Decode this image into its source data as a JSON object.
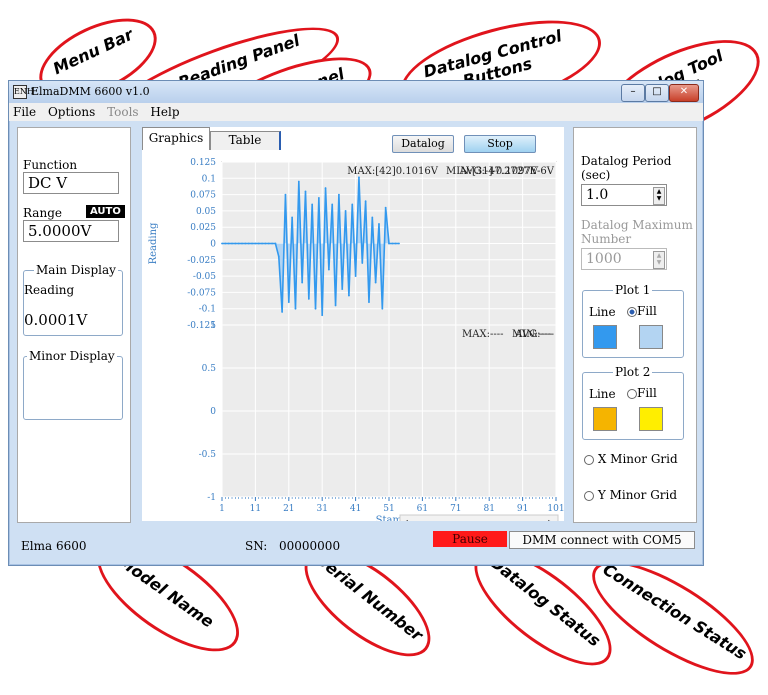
{
  "window": {
    "title": "ElmaDMM 6600 v1.0",
    "app_icon": "ENH"
  },
  "menu": {
    "items": [
      "File",
      "Options",
      "Tools",
      "Help"
    ]
  },
  "meter": {
    "function_label": "Function",
    "function_value": "DC V",
    "range_label": "Range",
    "range_mode": "AUTO",
    "range_value": "5.0000V",
    "main_display_label": "Main Display",
    "reading_label": "Reading",
    "reading_value": "0.0001V",
    "minor_display_label": "Minor Display"
  },
  "datalog": {
    "tabs": [
      "Graphics",
      "Table"
    ],
    "datalog_button": "Datalog",
    "stop_button": "Stop",
    "plot1": {
      "ylabel": "Reading",
      "yticks": [
        "0.125",
        "0.1",
        "0.075",
        "0.05",
        "0.025",
        "0",
        "-0.025",
        "-0.05",
        "-0.075",
        "-0.1",
        "-0.125"
      ],
      "stats": {
        "max": "MAX:[42]0.1016V",
        "min": "MIN:[31]-0.1097V",
        "avg": "AVG:-47.2727E-6V"
      }
    },
    "plot2": {
      "yticks": [
        "1",
        "0.5",
        "0",
        "-0.5",
        "-1"
      ],
      "xticks": [
        "1",
        "11",
        "21",
        "31",
        "41",
        "51",
        "61",
        "71",
        "81",
        "91",
        "101"
      ],
      "xlabel": "Stamp",
      "stats": {
        "max": "MAX:----",
        "min": "MIN:----",
        "avg": "AVG:----"
      }
    }
  },
  "tool": {
    "period_label": "Datalog Period",
    "period_unit": "(sec)",
    "period_value": "1.0",
    "max_label": "Datalog Maximum",
    "max_label2": "Number",
    "max_value": "1000",
    "plot1_label": "Plot 1",
    "plot2_label": "Plot 2",
    "line_label": "Line",
    "fill_label": "Fill",
    "plot1_line_color": "#3399ee",
    "plot1_fill_color": "#b3d4f2",
    "plot2_line_color": "#f5b400",
    "plot2_fill_color": "#ffee00",
    "x_minor_grid": "X Minor Grid",
    "y_minor_grid": "Y Minor Grid"
  },
  "status": {
    "model": "Elma 6600",
    "sn_label": "SN:",
    "sn_value": "00000000",
    "datalog_status": "Pause",
    "connection": "DMM connect with COM5"
  },
  "annotations": [
    "Menu Bar",
    "Meter Reading Panel",
    "Datalog Panel",
    "Datalog Control Buttons",
    "Datalog Tool Panel",
    "Model Name",
    "Serial Number",
    "Datalog Status",
    "Connection Status"
  ],
  "chart_data": {
    "type": "line",
    "xlabel": "Stamp",
    "ylabel": "Reading",
    "ylim": [
      -0.125,
      0.125
    ],
    "xlim": [
      1,
      101
    ],
    "x": [
      1,
      2,
      3,
      4,
      5,
      6,
      7,
      8,
      9,
      10,
      11,
      12,
      13,
      14,
      15,
      16,
      17,
      18,
      19,
      20,
      21,
      22,
      23,
      24,
      25,
      26,
      27,
      28,
      29,
      30,
      31,
      32,
      33,
      34,
      35,
      36,
      37,
      38,
      39,
      40,
      41,
      42,
      43,
      44,
      45,
      46,
      47,
      48,
      49,
      50,
      51,
      52,
      53,
      54,
      55,
      56,
      57,
      58,
      59,
      60,
      61,
      62,
      63,
      64,
      65,
      66,
      67,
      68,
      69,
      70,
      71,
      72,
      73,
      74,
      75,
      76,
      77,
      78,
      79,
      80,
      81,
      82,
      83,
      84,
      85,
      86,
      87,
      88,
      89,
      90,
      91,
      92,
      93,
      94,
      95,
      96,
      97,
      98,
      99,
      100,
      101
    ],
    "values": [
      0,
      0,
      0,
      0,
      0,
      0,
      0,
      0,
      0,
      0,
      0,
      0,
      0,
      0,
      0,
      0,
      0,
      -0.02,
      -0.105,
      0.075,
      -0.09,
      0.04,
      -0.1,
      0.095,
      -0.06,
      0.08,
      -0.085,
      0.06,
      -0.1,
      0.07,
      -0.11,
      0.085,
      -0.04,
      0.06,
      -0.095,
      0.075,
      -0.07,
      0.05,
      -0.08,
      0.06,
      -0.05,
      0.1016,
      -0.03,
      0.065,
      -0.09,
      0.04,
      -0.06,
      0.03,
      -0.1,
      0.055,
      0,
      0,
      0,
      0,
      0,
      0,
      0,
      0,
      0,
      0,
      0,
      0,
      0,
      0,
      0,
      0,
      0,
      0,
      0,
      0,
      0,
      0,
      0,
      0,
      0,
      0,
      0,
      0,
      0,
      0,
      0,
      0,
      0,
      0,
      0,
      0,
      0,
      0,
      0,
      0,
      0,
      0,
      0,
      0,
      0,
      0,
      0,
      0,
      0,
      0,
      0
    ]
  }
}
